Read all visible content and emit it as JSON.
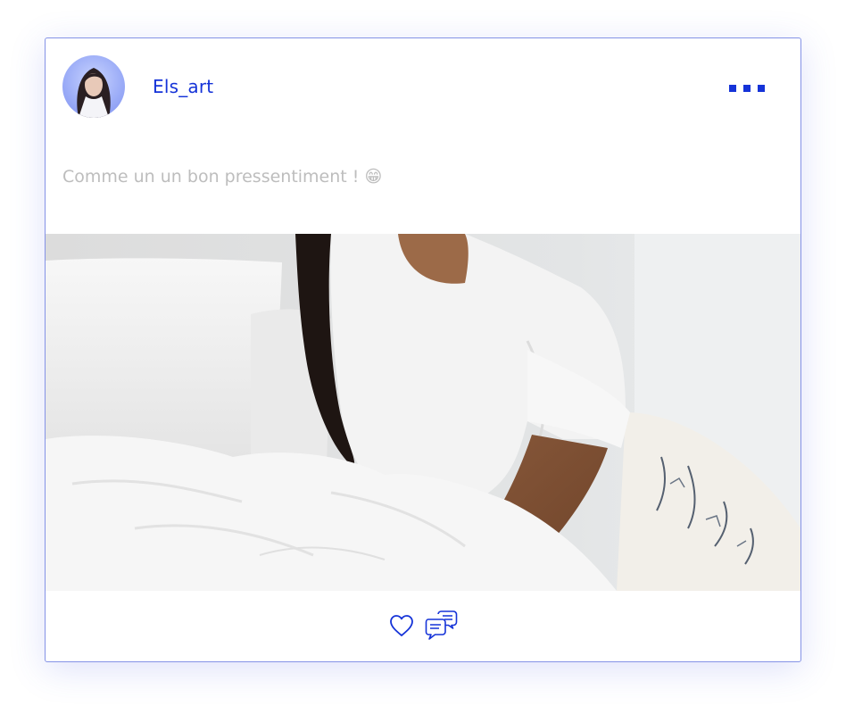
{
  "post": {
    "author": "Els_art",
    "text": "Comme un un bon pressentiment ! 😁",
    "menu_icon": "more-horizontal-icon",
    "actions": [
      {
        "name": "like",
        "icon": "heart-outline-icon"
      },
      {
        "name": "comment",
        "icon": "chat-bubbles-icon"
      }
    ]
  },
  "colors": {
    "accent": "#1533d8",
    "card_border": "#8593e6",
    "text_muted": "#bdbdbd"
  }
}
